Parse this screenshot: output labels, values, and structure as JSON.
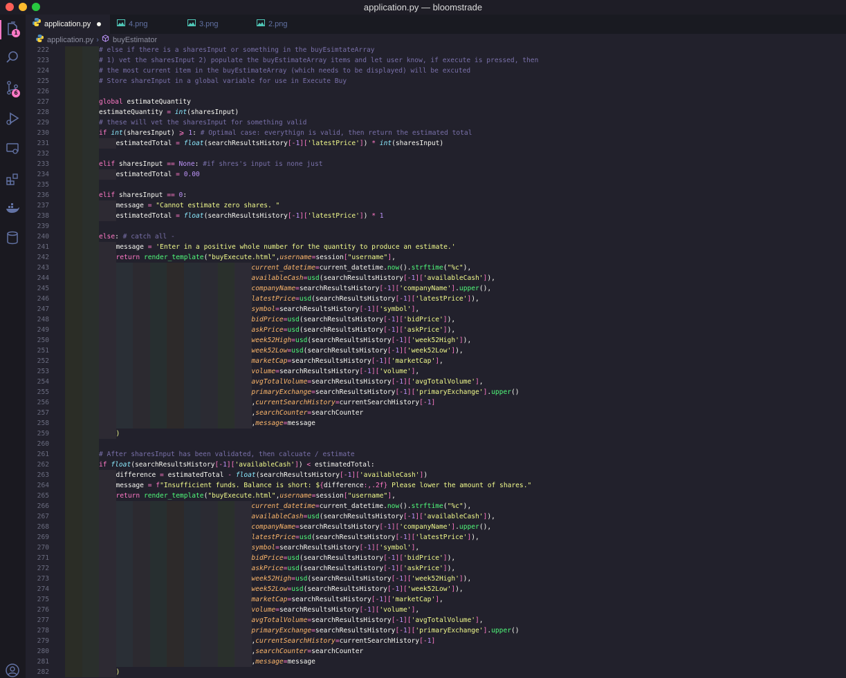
{
  "window": {
    "title": "application.py — bloomstrade"
  },
  "tabs": [
    {
      "label": "application.py",
      "modified": true
    },
    {
      "label": "4.png"
    },
    {
      "label": "3.png"
    },
    {
      "label": "2.png"
    }
  ],
  "breadcrumb": {
    "file": "application.py",
    "symbol": "buyEstimator"
  },
  "activity": {
    "explorer_badge": "1",
    "scm_badge": "6"
  },
  "colors": {
    "background": "#22212c",
    "accent": "#ff79c6",
    "string": "#f1fa8c",
    "comment": "#7970a9",
    "function": "#8be9fd",
    "parameter": "#ffb86c"
  },
  "code_lines": [
    {
      "n": "222",
      "indent": 2,
      "html": "<span class='comment'># else if there is a sharesInput or something in the buyEsimtateArray</span>"
    },
    {
      "n": "223",
      "indent": 2,
      "html": "<span class='comment'># 1) vet the sharesInput 2) populate the buyEstimateArray items and let user know, if execute is pressed, then</span>"
    },
    {
      "n": "224",
      "indent": 2,
      "html": "<span class='comment'># the most current item in the buyEstimateArray (which needs to be displayed) will be excuted</span>"
    },
    {
      "n": "225",
      "indent": 2,
      "html": "<span class='comment'># Store shareInput in a global variable for use in Execute Buy</span>"
    },
    {
      "n": "226",
      "indent": 2,
      "html": ""
    },
    {
      "n": "227",
      "indent": 2,
      "html": "<span class='kw'>global</span> estimateQuantity"
    },
    {
      "n": "228",
      "indent": 2,
      "html": "estimateQuantity <span class='op'>=</span> <span class='fn'>int</span>(sharesInput)"
    },
    {
      "n": "229",
      "indent": 2,
      "html": "<span class='comment'># these will vet the sharesInput for something valid</span>"
    },
    {
      "n": "230",
      "indent": 2,
      "html": "<span class='kw'>if</span> <span class='fn'>int</span>(sharesInput) <span class='op'>⩾</span> <span class='num'>1</span>: <span class='comment'># Optimal case: everythign is valid, then return the estimated total</span>"
    },
    {
      "n": "231",
      "indent": 3,
      "html": "estimatedTotal <span class='op'>=</span> <span class='fn'>float</span>(searchResultsHistory<span class='bracket'>[</span><span class='op'>-</span><span class='num'>1</span><span class='bracket'>][</span><span class='str'>'latestPrice'</span><span class='bracket'>]</span>) <span class='op'>*</span> <span class='fn'>int</span>(sharesInput)"
    },
    {
      "n": "232",
      "indent": 2,
      "html": ""
    },
    {
      "n": "233",
      "indent": 2,
      "html": "<span class='kw'>elif</span> sharesInput <span class='op'>==</span> <span class='const'>None</span>: <span class='comment'>#if shres's input is none just</span>"
    },
    {
      "n": "234",
      "indent": 3,
      "html": "estimatedTotal <span class='op'>=</span> <span class='num'>0.00</span>"
    },
    {
      "n": "235",
      "indent": 2,
      "html": ""
    },
    {
      "n": "236",
      "indent": 2,
      "html": "<span class='kw'>elif</span> sharesInput <span class='op'>==</span> <span class='num'>0</span>:"
    },
    {
      "n": "237",
      "indent": 3,
      "html": "message <span class='op'>=</span> <span class='str'>\"Cannot estimate zero shares. \"</span>"
    },
    {
      "n": "238",
      "indent": 3,
      "html": "estimatedTotal <span class='op'>=</span> <span class='fn'>float</span>(searchResultsHistory<span class='bracket'>[</span><span class='op'>-</span><span class='num'>1</span><span class='bracket'>][</span><span class='str'>'latestPrice'</span><span class='bracket'>]</span>) <span class='op'>*</span> <span class='num'>1</span>"
    },
    {
      "n": "239",
      "indent": 2,
      "html": ""
    },
    {
      "n": "240",
      "indent": 2,
      "html": "<span class='kw'>else</span>: <span class='comment'># catch all -</span>"
    },
    {
      "n": "241",
      "indent": 3,
      "html": "message <span class='op'>=</span> <span class='str'>'Enter in a positive whole number for the quantity to produce an estimate.'</span>"
    },
    {
      "n": "242",
      "indent": 3,
      "html": "<span class='kw'>return</span> <span class='call'>render_template</span>(<span class='str'>\"buyExecute.html\"</span>,<span class='param'>username</span><span class='op'>=</span>session<span class='bracket'>[</span><span class='str'>\"username\"</span><span class='bracket'>]</span>,"
    },
    {
      "n": "243",
      "indent": 11,
      "html": "<span class='param'>current_datetime</span><span class='op'>=</span>current_datetime.<span class='call'>now</span>().<span class='call'>strftime</span>(<span class='str'>\"%c\"</span>),"
    },
    {
      "n": "244",
      "indent": 11,
      "html": "<span class='param'>availableCash</span><span class='op'>=</span><span class='call'>usd</span>(searchResultsHistory<span class='bracket'>[</span><span class='op'>-</span><span class='num'>1</span><span class='bracket'>][</span><span class='str'>'availableCash'</span><span class='bracket'>]</span>),"
    },
    {
      "n": "245",
      "indent": 11,
      "html": "<span class='param'>companyName</span><span class='op'>=</span>searchResultsHistory<span class='bracket'>[</span><span class='op'>-</span><span class='num'>1</span><span class='bracket'>][</span><span class='str'>'companyName'</span><span class='bracket'>]</span>.<span class='call'>upper</span>(),"
    },
    {
      "n": "246",
      "indent": 11,
      "html": "<span class='param'>latestPrice</span><span class='op'>=</span><span class='call'>usd</span>(searchResultsHistory<span class='bracket'>[</span><span class='op'>-</span><span class='num'>1</span><span class='bracket'>][</span><span class='str'>'latestPrice'</span><span class='bracket'>]</span>),"
    },
    {
      "n": "247",
      "indent": 11,
      "html": "<span class='param'>symbol</span><span class='op'>=</span>searchResultsHistory<span class='bracket'>[</span><span class='op'>-</span><span class='num'>1</span><span class='bracket'>][</span><span class='str'>'symbol'</span><span class='bracket'>]</span>,"
    },
    {
      "n": "248",
      "indent": 11,
      "html": "<span class='param'>bidPrice</span><span class='op'>=</span><span class='call'>usd</span>(searchResultsHistory<span class='bracket'>[</span><span class='op'>-</span><span class='num'>1</span><span class='bracket'>][</span><span class='str'>'bidPrice'</span><span class='bracket'>]</span>),"
    },
    {
      "n": "249",
      "indent": 11,
      "html": "<span class='param'>askPrice</span><span class='op'>=</span><span class='call'>usd</span>(searchResultsHistory<span class='bracket'>[</span><span class='op'>-</span><span class='num'>1</span><span class='bracket'>][</span><span class='str'>'askPrice'</span><span class='bracket'>]</span>),"
    },
    {
      "n": "250",
      "indent": 11,
      "html": "<span class='param'>week52High</span><span class='op'>=</span><span class='call'>usd</span>(searchResultsHistory<span class='bracket'>[</span><span class='op'>-</span><span class='num'>1</span><span class='bracket'>][</span><span class='str'>'week52High'</span><span class='bracket'>]</span>),"
    },
    {
      "n": "251",
      "indent": 11,
      "html": "<span class='param'>week52Low</span><span class='op'>=</span><span class='call'>usd</span>(searchResultsHistory<span class='bracket'>[</span><span class='op'>-</span><span class='num'>1</span><span class='bracket'>][</span><span class='str'>'week52Low'</span><span class='bracket'>]</span>),"
    },
    {
      "n": "252",
      "indent": 11,
      "html": "<span class='param'>marketCap</span><span class='op'>=</span>searchResultsHistory<span class='bracket'>[</span><span class='op'>-</span><span class='num'>1</span><span class='bracket'>][</span><span class='str'>'marketCap'</span><span class='bracket'>]</span>,"
    },
    {
      "n": "253",
      "indent": 11,
      "html": "<span class='param'>volume</span><span class='op'>=</span>searchResultsHistory<span class='bracket'>[</span><span class='op'>-</span><span class='num'>1</span><span class='bracket'>][</span><span class='str'>'volume'</span><span class='bracket'>]</span>,"
    },
    {
      "n": "254",
      "indent": 11,
      "html": "<span class='param'>avgTotalVolume</span><span class='op'>=</span>searchResultsHistory<span class='bracket'>[</span><span class='op'>-</span><span class='num'>1</span><span class='bracket'>][</span><span class='str'>'avgTotalVolume'</span><span class='bracket'>]</span>,"
    },
    {
      "n": "255",
      "indent": 11,
      "html": "<span class='param'>primaryExchange</span><span class='op'>=</span>searchResultsHistory<span class='bracket'>[</span><span class='op'>-</span><span class='num'>1</span><span class='bracket'>][</span><span class='str'>'primaryExchange'</span><span class='bracket'>]</span>.<span class='call'>upper</span>()"
    },
    {
      "n": "256",
      "indent": 11,
      "html": ",<span class='param'>currentSearchHistory</span><span class='op'>=</span>currentSearchHistory<span class='bracket'>[</span><span class='op'>-</span><span class='num'>1</span><span class='bracket'>]</span>"
    },
    {
      "n": "257",
      "indent": 11,
      "html": ",<span class='param'>searchCounter</span><span class='op'>=</span>searchCounter"
    },
    {
      "n": "258",
      "indent": 11,
      "html": ",<span class='param'>message</span><span class='op'>=</span>message"
    },
    {
      "n": "259",
      "indent": 3,
      "html": "<span class='str'>)</span>"
    },
    {
      "n": "260",
      "indent": 2,
      "html": ""
    },
    {
      "n": "261",
      "indent": 2,
      "html": "<span class='comment'># After sharesInput has been validated, then calcuate / estimate</span>"
    },
    {
      "n": "262",
      "indent": 2,
      "html": "<span class='kw'>if</span> <span class='fn'>float</span>(searchResultsHistory<span class='bracket'>[</span><span class='op'>-</span><span class='num'>1</span><span class='bracket'>][</span><span class='str'>'availableCash'</span><span class='bracket'>]</span>) <span class='op'>&lt;</span> estimatedTotal:"
    },
    {
      "n": "263",
      "indent": 3,
      "html": "difference <span class='op'>=</span> estimatedTotal <span class='op'>-</span> <span class='fn'>float</span>(searchResultsHistory<span class='bracket'>[</span><span class='op'>-</span><span class='num'>1</span><span class='bracket'>][</span><span class='str'>'availableCash'</span><span class='bracket'>]</span>)"
    },
    {
      "n": "264",
      "indent": 3,
      "html": "message <span class='op'>=</span> <span class='kw'>f</span><span class='str'>\"Insufficient funds. Balance is short: $</span><span class='kw'>{</span>difference<span class='kw'>:,.2f}</span><span class='str'> Please lower the amount of shares.\"</span>"
    },
    {
      "n": "265",
      "indent": 3,
      "html": "<span class='kw'>return</span> <span class='call'>render_template</span>(<span class='str'>\"buyExecute.html\"</span>,<span class='param'>username</span><span class='op'>=</span>session<span class='bracket'>[</span><span class='str'>\"username\"</span><span class='bracket'>]</span>,"
    },
    {
      "n": "266",
      "indent": 11,
      "html": "<span class='param'>current_datetime</span><span class='op'>=</span>current_datetime.<span class='call'>now</span>().<span class='call'>strftime</span>(<span class='str'>\"%c\"</span>),"
    },
    {
      "n": "267",
      "indent": 11,
      "html": "<span class='param'>availableCash</span><span class='op'>=</span><span class='call'>usd</span>(searchResultsHistory<span class='bracket'>[</span><span class='op'>-</span><span class='num'>1</span><span class='bracket'>][</span><span class='str'>'availableCash'</span><span class='bracket'>]</span>),"
    },
    {
      "n": "268",
      "indent": 11,
      "html": "<span class='param'>companyName</span><span class='op'>=</span>searchResultsHistory<span class='bracket'>[</span><span class='op'>-</span><span class='num'>1</span><span class='bracket'>][</span><span class='str'>'companyName'</span><span class='bracket'>]</span>.<span class='call'>upper</span>(),"
    },
    {
      "n": "269",
      "indent": 11,
      "html": "<span class='param'>latestPrice</span><span class='op'>=</span><span class='call'>usd</span>(searchResultsHistory<span class='bracket'>[</span><span class='op'>-</span><span class='num'>1</span><span class='bracket'>][</span><span class='str'>'latestPrice'</span><span class='bracket'>]</span>),"
    },
    {
      "n": "270",
      "indent": 11,
      "html": "<span class='param'>symbol</span><span class='op'>=</span>searchResultsHistory<span class='bracket'>[</span><span class='op'>-</span><span class='num'>1</span><span class='bracket'>][</span><span class='str'>'symbol'</span><span class='bracket'>]</span>,"
    },
    {
      "n": "271",
      "indent": 11,
      "html": "<span class='param'>bidPrice</span><span class='op'>=</span><span class='call'>usd</span>(searchResultsHistory<span class='bracket'>[</span><span class='op'>-</span><span class='num'>1</span><span class='bracket'>][</span><span class='str'>'bidPrice'</span><span class='bracket'>]</span>),"
    },
    {
      "n": "272",
      "indent": 11,
      "html": "<span class='param'>askPrice</span><span class='op'>=</span><span class='call'>usd</span>(searchResultsHistory<span class='bracket'>[</span><span class='op'>-</span><span class='num'>1</span><span class='bracket'>][</span><span class='str'>'askPrice'</span><span class='bracket'>]</span>),"
    },
    {
      "n": "273",
      "indent": 11,
      "html": "<span class='param'>week52High</span><span class='op'>=</span><span class='call'>usd</span>(searchResultsHistory<span class='bracket'>[</span><span class='op'>-</span><span class='num'>1</span><span class='bracket'>][</span><span class='str'>'week52High'</span><span class='bracket'>]</span>),"
    },
    {
      "n": "274",
      "indent": 11,
      "html": "<span class='param'>week52Low</span><span class='op'>=</span><span class='call'>usd</span>(searchResultsHistory<span class='bracket'>[</span><span class='op'>-</span><span class='num'>1</span><span class='bracket'>][</span><span class='str'>'week52Low'</span><span class='bracket'>]</span>),"
    },
    {
      "n": "275",
      "indent": 11,
      "html": "<span class='param'>marketCap</span><span class='op'>=</span>searchResultsHistory<span class='bracket'>[</span><span class='op'>-</span><span class='num'>1</span><span class='bracket'>][</span><span class='str'>'marketCap'</span><span class='bracket'>]</span>,"
    },
    {
      "n": "276",
      "indent": 11,
      "html": "<span class='param'>volume</span><span class='op'>=</span>searchResultsHistory<span class='bracket'>[</span><span class='op'>-</span><span class='num'>1</span><span class='bracket'>][</span><span class='str'>'volume'</span><span class='bracket'>]</span>,"
    },
    {
      "n": "277",
      "indent": 11,
      "html": "<span class='param'>avgTotalVolume</span><span class='op'>=</span>searchResultsHistory<span class='bracket'>[</span><span class='op'>-</span><span class='num'>1</span><span class='bracket'>][</span><span class='str'>'avgTotalVolume'</span><span class='bracket'>]</span>,"
    },
    {
      "n": "278",
      "indent": 11,
      "html": "<span class='param'>primaryExchange</span><span class='op'>=</span>searchResultsHistory<span class='bracket'>[</span><span class='op'>-</span><span class='num'>1</span><span class='bracket'>][</span><span class='str'>'primaryExchange'</span><span class='bracket'>]</span>.<span class='call'>upper</span>()"
    },
    {
      "n": "279",
      "indent": 11,
      "html": ",<span class='param'>currentSearchHistory</span><span class='op'>=</span>currentSearchHistory<span class='bracket'>[</span><span class='op'>-</span><span class='num'>1</span><span class='bracket'>]</span>"
    },
    {
      "n": "280",
      "indent": 11,
      "html": ",<span class='param'>searchCounter</span><span class='op'>=</span>searchCounter"
    },
    {
      "n": "281",
      "indent": 11,
      "html": ",<span class='param'>message</span><span class='op'>=</span>message"
    },
    {
      "n": "282",
      "indent": 3,
      "html": "<span class='str'>)</span>"
    }
  ]
}
